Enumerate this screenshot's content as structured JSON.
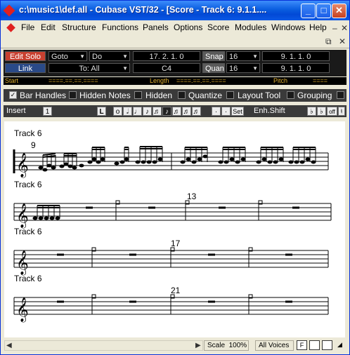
{
  "window": {
    "title": "c:\\music1\\def.all - Cubase VST/32 - [Score - Track 6:  9.1.1....",
    "buttons": {
      "minimize": "_",
      "maximize": "□",
      "close": "✕"
    }
  },
  "menu": {
    "items": [
      "File",
      "Edit",
      "Structure",
      "Functions",
      "Panels",
      "Options",
      "Score",
      "Modules",
      "Windows",
      "Help"
    ],
    "mdi": {
      "minimize": "–",
      "close": "✕",
      "restore": "⧉"
    }
  },
  "info": {
    "edit_solo": "Edit Solo",
    "link": "Link",
    "goto": "Goto",
    "do": "Do",
    "to_all": "To: All",
    "position": "17. 2. 1.    0",
    "pitch": "C4",
    "snap_label": "Snap",
    "snap_value": "16",
    "quant_label": "Quant",
    "quant_value": "16",
    "snap_pos": "9. 1. 1.    0",
    "quant_pos": "9. 1. 1.    0",
    "start_label": "Start",
    "start_value": "====.==.==.====",
    "length_label": "Length",
    "length_value": "====.==.==.====",
    "pitch_label": "Pitch",
    "pitch_value": "===="
  },
  "options": {
    "bar_handles": "Bar Handles",
    "hidden_notes": "Hidden Notes",
    "hidden": "Hidden",
    "quantize": "Quantize",
    "layout_tool": "Layout Tool",
    "grouping": "Grouping"
  },
  "insert_bar": {
    "insert_label": "Insert",
    "insert_value": "1",
    "l_button": "L",
    "set_label": "Set",
    "enh_shift": "Enh.Shift",
    "off": "off"
  },
  "score": {
    "systems": [
      {
        "track": "Track 6",
        "bar_number": "9"
      },
      {
        "track": "Track 6",
        "bar_number": "13"
      },
      {
        "track": "Track 6",
        "bar_number": "17"
      },
      {
        "track": "Track 6",
        "bar_number": "21"
      }
    ]
  },
  "status": {
    "scale_label": "Scale",
    "scale_value": "100%",
    "voices": "All Voices",
    "f_box": "F"
  }
}
